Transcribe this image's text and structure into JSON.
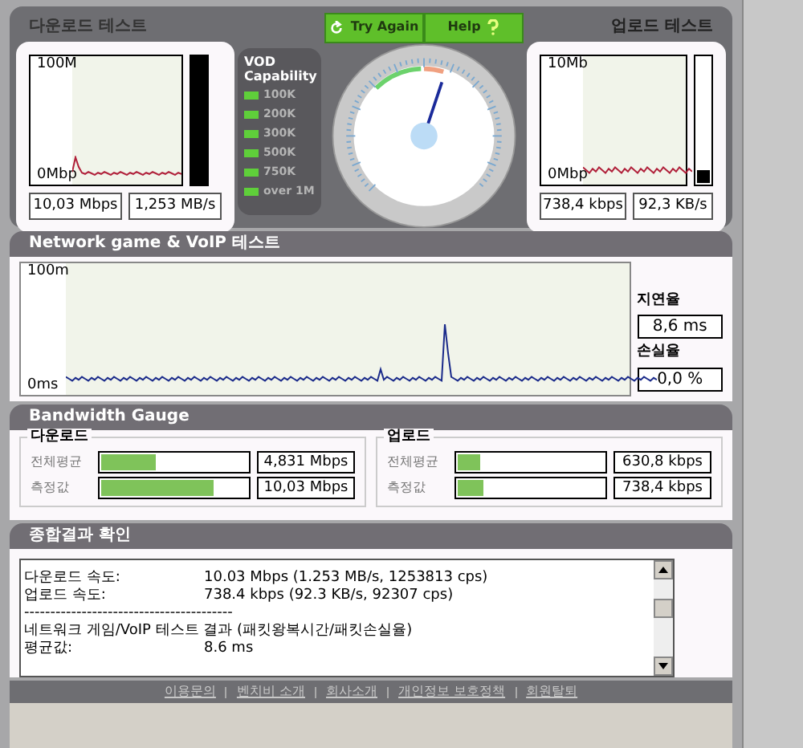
{
  "download_test": {
    "title": "다운로드 테스트",
    "y_max": "100M",
    "y_min": "0Mbp",
    "readouts": [
      "10,03 Mbps",
      "1,253 MB/s"
    ]
  },
  "vod": {
    "title": "VOD Capability",
    "items": [
      {
        "label": "100K",
        "on": true
      },
      {
        "label": "200K",
        "on": true
      },
      {
        "label": "300K",
        "on": true
      },
      {
        "label": "500K",
        "on": true
      },
      {
        "label": "750K",
        "on": true
      },
      {
        "label": "over 1M",
        "on": true
      }
    ]
  },
  "buttons": [
    {
      "label": "Try Again",
      "kind": "retry"
    },
    {
      "label": "Help",
      "kind": "help"
    }
  ],
  "upload_test": {
    "title": "업로드 테스트",
    "y_max": "10Mb",
    "y_min": "0Mbp",
    "readouts": [
      "738,4 kbps",
      "92,3 KB/s"
    ]
  },
  "network_test": {
    "title": "Network game & VoIP 테스트",
    "y_max": "100m",
    "y_min": "0ms",
    "latency_label": "지연율",
    "latency": "8,6 ms",
    "loss_label": "손실율",
    "loss": "0,0 %"
  },
  "bandwidth_gauge": {
    "title": "Bandwidth Gauge",
    "groups": [
      {
        "title": "다운로드",
        "rows": [
          {
            "label": "전체평균",
            "level": 0.37,
            "value": "4,831 Mbps"
          },
          {
            "label": "측정값",
            "level": 0.77,
            "value": "10,03 Mbps"
          }
        ]
      },
      {
        "title": "업로드",
        "rows": [
          {
            "label": "전체평균",
            "level": 0.15,
            "value": "630,8 kbps"
          },
          {
            "label": "측정값",
            "level": 0.18,
            "value": "738,4 kbps"
          }
        ]
      }
    ]
  },
  "summary": {
    "title": "종합결과 확인",
    "lines": [
      {
        "kind": "pair",
        "label": "다운로드 속도:",
        "value": "10.03 Mbps (1.253 MB/s, 1253813 cps)"
      },
      {
        "kind": "pair",
        "label": "업로드 속도:",
        "value": "738.4 kbps (92.3 KB/s, 92307 cps)"
      },
      {
        "kind": "text",
        "text": "----------------------------------------"
      },
      {
        "kind": "text",
        "text": "네트워크 게임/VoIP 테스트 결과 (패킷왕복시간/패킷손실율)"
      },
      {
        "kind": "pair",
        "label": "평균값:",
        "value": "8.6 ms"
      }
    ]
  },
  "footer_links": [
    "이용문의",
    "벤치비 소개",
    "회사소개",
    "개인정보 보호정책",
    "회원탈퇴"
  ]
}
